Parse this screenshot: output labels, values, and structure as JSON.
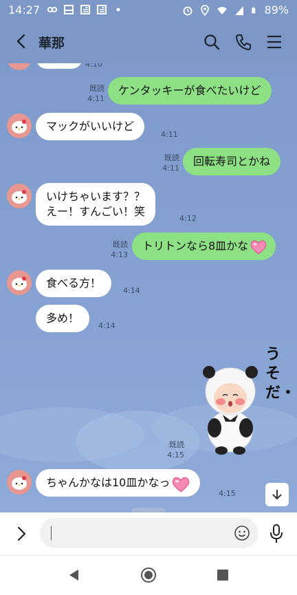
{
  "status_bar": {
    "time": "14:27",
    "battery": "89%",
    "left_icons": [
      "link-icon",
      "notebook-icon",
      "news-icon",
      "news-icon",
      "dot-icon"
    ],
    "right_icons": [
      "alarm-icon",
      "location-icon",
      "wifi-icon",
      "signal-icon",
      "battery-icon"
    ]
  },
  "header": {
    "title": "華那",
    "icons": [
      "back-icon",
      "search-icon",
      "phone-icon",
      "menu-icon"
    ]
  },
  "messages": [
    {
      "side": "in",
      "text": "",
      "time": "4:10"
    },
    {
      "side": "out",
      "text": "ケンタッキーが食べたいけど",
      "read": "既読",
      "time": "4:11"
    },
    {
      "side": "in",
      "text": "マックがいいけど",
      "time": "4:11"
    },
    {
      "side": "out",
      "text": "回転寿司とかね",
      "read": "既読",
      "time": "4:11"
    },
    {
      "side": "in",
      "line1": "いけちゃいます？？",
      "line2": "えー！すんごい！笑",
      "time": "4:12"
    },
    {
      "side": "out",
      "text": "トリトンなら8皿かな",
      "read": "既読",
      "time": "4:13"
    },
    {
      "side": "in",
      "text": "食べる方！",
      "time": "4:14"
    },
    {
      "side": "in",
      "text": "多め！",
      "time": "4:14"
    },
    {
      "side": "out",
      "type": "sticker",
      "sticker_text": "うそだ・・・",
      "read": "既読",
      "time": "4:15"
    },
    {
      "side": "in",
      "text": "ちゃんかなは10皿かなっ",
      "time": "4:15"
    }
  ],
  "input": {
    "placeholder": ""
  },
  "colors": {
    "header_bg": "#7d98c7",
    "chat_bg": "#87a3d3",
    "out_bubble": "#8de184",
    "in_bubble": "#ffffff",
    "avatar_bg": "#e79690"
  }
}
